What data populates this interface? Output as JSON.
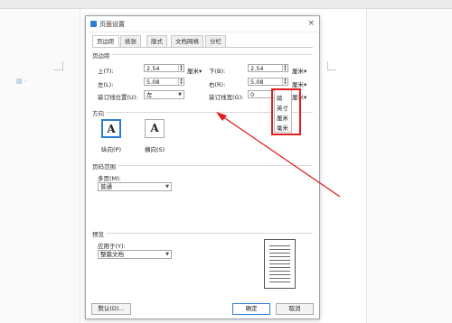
{
  "doc": {
    "side_icon": "document-icon"
  },
  "dialog": {
    "title": "页面设置",
    "close": "×",
    "tabs": [
      {
        "label": "页边距",
        "active": true
      },
      {
        "label": "纸张",
        "active": false
      },
      {
        "label": "版式",
        "active": false
      },
      {
        "label": "文档网格",
        "active": false
      },
      {
        "label": "分栏",
        "active": false
      }
    ],
    "margins": {
      "section": "页边距",
      "top_label": "上(T):",
      "top_value": "2.54",
      "top_unit": "厘米",
      "bottom_label": "下(B):",
      "bottom_value": "2.54",
      "bottom_unit": "厘米",
      "left_label": "左(L):",
      "left_value": "5.08",
      "right_label": "右(R):",
      "right_value": "5.08",
      "right_unit": "厘米",
      "gutter_pos_label": "装订线位置(U):",
      "gutter_pos_value": "左",
      "gutter_width_label": "装订线宽(G):",
      "gutter_width_value": "0",
      "gutter_width_unit": "厘米"
    },
    "unit_popup": [
      "磅",
      "英寸",
      "厘米",
      "毫米"
    ],
    "orientation": {
      "section": "方向",
      "portrait_label": "纵向(P)",
      "landscape_label": "横向(S)",
      "glyph": "A",
      "selected": "portrait"
    },
    "page_range": {
      "section": "页码范围",
      "multi_label": "多页(M):",
      "multi_value": "普通"
    },
    "preview": {
      "section": "预览",
      "apply_label": "应用于(Y):",
      "apply_value": "整篇文档"
    },
    "buttons": {
      "default": "默认(D)...",
      "ok": "确定",
      "cancel": "取消"
    },
    "colors": {
      "accent": "#2b7fd6",
      "annotation": "#e21c1c"
    }
  }
}
